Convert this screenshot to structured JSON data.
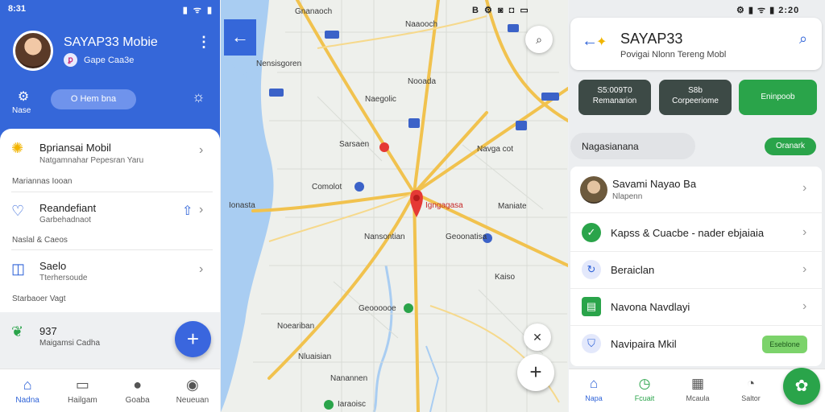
{
  "left": {
    "status_time": "8:31",
    "status_icons": "▮ ᯤ ▮",
    "title": "SAYAP33 Mobie",
    "subtitle": "Gape Caa3e",
    "badge": "ꝑ",
    "nav_label": "Nase",
    "pill_label": "O Hem bna",
    "rows": [
      {
        "title": "Bpriansai Mobil",
        "subtitle": "Natgamnahar Pepesran Yaru"
      },
      {
        "title": "Reandefiant",
        "subtitle": "Garbehadnaot"
      },
      {
        "title": "Saelo",
        "subtitle": "Tterhersoude"
      },
      {
        "title": "937",
        "subtitle": "Maigamsi Cadha"
      }
    ],
    "sections": [
      "Mariannas Iooan",
      "Naslal & Caeos",
      "Starbaoer Vagt"
    ],
    "bottom_nav": [
      {
        "label": "Nadna",
        "icon": "home-icon"
      },
      {
        "label": "Hailgam",
        "icon": "chat-icon"
      },
      {
        "label": "Goaba",
        "icon": "globe-icon"
      },
      {
        "label": "Neueuan",
        "icon": "people-icon"
      }
    ]
  },
  "map": {
    "status": "B ⚙ ◙ ◘ ▭",
    "pin_label": "Igngagasa",
    "labels": {
      "l1": "Gnanaoch",
      "l2": "Naaooch",
      "l3": "Nensisgoren",
      "l4": "Nooada",
      "l5": "Naegolic",
      "l6": "Sarsaen",
      "l7": "Navga cot",
      "l8": "Comolot",
      "l9": "Ionasta",
      "l10": "Maniate",
      "l11": "Nansontian",
      "l12": "Geoonatisa",
      "l13": "Geoooooe",
      "l14": "Noeariban",
      "l15": "Nluaisian",
      "l16": "Nanannen",
      "l17": "Kaiso",
      "l18": "Iaraoisc"
    }
  },
  "right": {
    "status": "⚙ ▮ ᯤ ▮ 2:20",
    "title": "SAYAP33",
    "subtitle": "Povigai Nlonn Tereng Mobl",
    "chips": [
      {
        "l1": "S5:009T0",
        "l2": "Remanarion"
      },
      {
        "l1": "S8b",
        "l2": "Corpeeriome"
      },
      {
        "l1": "Eninpoob",
        "l2": ""
      }
    ],
    "search_text": "Nagasianana",
    "search_button": "Oranark",
    "user": {
      "name": "Savami Nayao Ba",
      "sub": "Nlapenn"
    },
    "items": [
      {
        "label": "Kapss & Cuacbe - nader ebjaiaia"
      },
      {
        "label": "Beraiclan"
      },
      {
        "label": "Navona Navdlayi"
      },
      {
        "label": "Navipaira Mkil",
        "tag": "Eseblone"
      }
    ],
    "bottom_nav": [
      {
        "label": "Napa"
      },
      {
        "label": "Fcuait"
      },
      {
        "label": "Mcaula"
      },
      {
        "label": "Saltor"
      }
    ]
  },
  "colors": {
    "primary_blue": "#3567d9",
    "green": "#2aa44a",
    "pin_red": "#e53935",
    "road": "#f1c24e",
    "water": "#a9cdf2"
  }
}
